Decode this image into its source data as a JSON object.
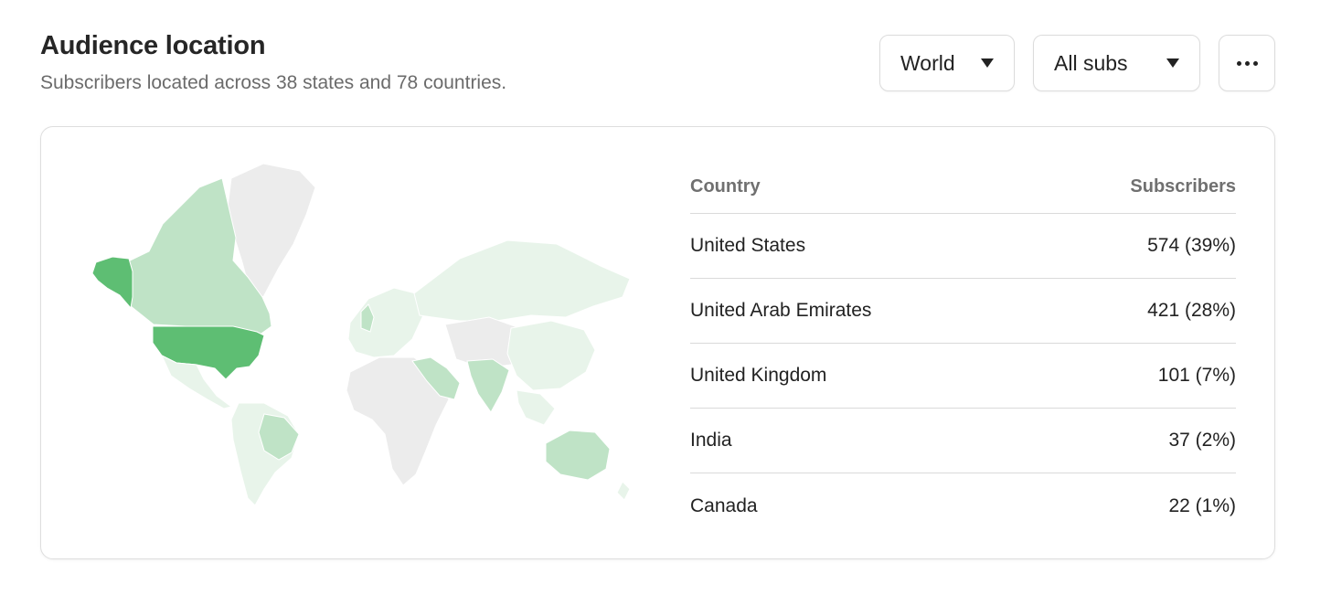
{
  "header": {
    "title": "Audience location",
    "subtitle": "Subscribers located across 38 states and 78 countries."
  },
  "controls": {
    "region_value": "World",
    "audience_value": "All subs"
  },
  "colors": {
    "darkest": "#5ebe73",
    "medium": "#bfe3c6",
    "light": "#e8f4ea",
    "no_data": "#ececec"
  },
  "table": {
    "col_country": "Country",
    "col_subscribers": "Subscribers",
    "rows": [
      {
        "country": "United States",
        "value": "574 (39%)"
      },
      {
        "country": "United Arab Emirates",
        "value": "421 (28%)"
      },
      {
        "country": "United Kingdom",
        "value": "101 (7%)"
      },
      {
        "country": "India",
        "value": "37 (2%)"
      },
      {
        "country": "Canada",
        "value": "22 (1%)"
      }
    ]
  }
}
